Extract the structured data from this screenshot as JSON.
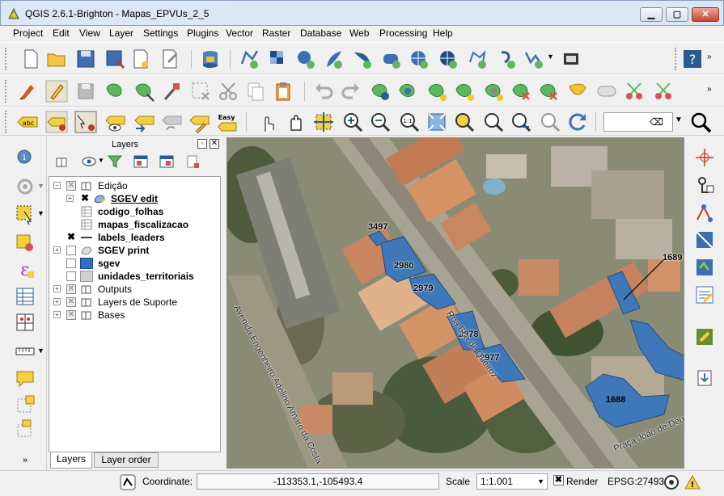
{
  "window": {
    "title": "QGIS 2.6.1-Brighton - Mapas_EPVUs_2_5",
    "minimize": "▁",
    "maximize": "▢",
    "close": "✕"
  },
  "menu": [
    "Project",
    "Edit",
    "View",
    "Layer",
    "Settings",
    "Plugins",
    "Vector",
    "Raster",
    "Database",
    "Web",
    "Processing",
    "Help"
  ],
  "layers_panel": {
    "title": "Layers",
    "float": "▫",
    "close": "✕",
    "tree": [
      {
        "label": "Edição",
        "checked": "✕",
        "expander": "−"
      },
      {
        "label": "SGEV edit",
        "checked": "✖",
        "expander": "+"
      },
      {
        "label": "codigo_folhas",
        "checked": ""
      },
      {
        "label": "mapas_fiscalizacao",
        "checked": ""
      },
      {
        "label": "labels_leaders",
        "checked": "✖"
      },
      {
        "label": "SGEV print",
        "checked": "",
        "expander": "+"
      },
      {
        "label": "sgev",
        "checked": ""
      },
      {
        "label": "unidades_territoriais",
        "checked": ""
      },
      {
        "label": "Outputs",
        "checked": "✕",
        "expander": "+"
      },
      {
        "label": "Layers de Suporte",
        "checked": "✕",
        "expander": "+"
      },
      {
        "label": "Bases",
        "checked": "✕",
        "expander": "+"
      }
    ],
    "tabs": [
      "Layers",
      "Layer order"
    ]
  },
  "map": {
    "parcels": [
      "3497",
      "2980",
      "2979",
      "2978",
      "2977",
      "1688",
      "1689"
    ],
    "streets": [
      "Rua Eça de Queiroz",
      "Avenida Engenheiro Adelino Amaro da Costa",
      "Praça João de Deus"
    ]
  },
  "statusbar": {
    "coordinate_label": "Coordinate:",
    "coordinate_value": "-113353.1,-105493.4",
    "scale_label": "Scale",
    "scale_value": "1:1.001",
    "render_label": "Render",
    "render_checked": "✖",
    "epsg": "EPSG:27493"
  },
  "colors": {
    "parcel_fill": "#3f78b8",
    "parcel_stroke": "#1f4c85"
  }
}
